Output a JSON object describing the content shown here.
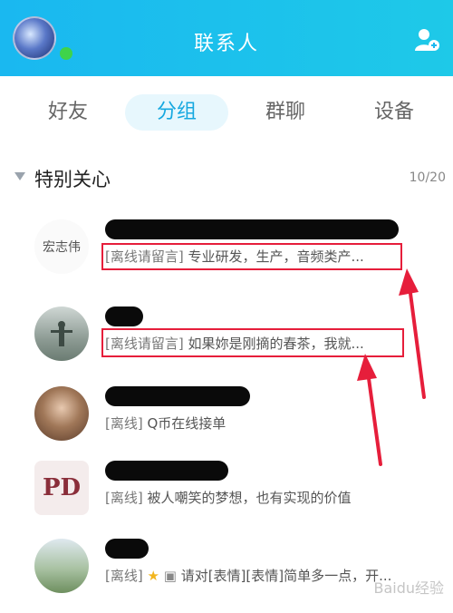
{
  "header": {
    "title": "联系人"
  },
  "tabs": [
    {
      "label": "好友"
    },
    {
      "label": "分组",
      "active": true
    },
    {
      "label": "群聊"
    },
    {
      "label": "设备"
    }
  ],
  "group": {
    "title": "特别关心",
    "count": "10/20",
    "expanded": true
  },
  "contacts": [
    {
      "avatar_text": "宏志伟",
      "status_tag": "[离线请留言]",
      "status_text": "专业研发，生产，音频类产..."
    },
    {
      "avatar_text": "",
      "status_tag": "[离线请留言]",
      "status_text": "如果妳是刚摘的春茶，我就..."
    },
    {
      "avatar_text": "",
      "status_tag": "[离线]",
      "status_text": "Q币在线接单"
    },
    {
      "avatar_text": "PD",
      "status_tag": "[离线]",
      "status_text": "被人嘲笑的梦想，也有实现的价值"
    },
    {
      "avatar_text": "",
      "status_tag": "[离线]",
      "status_text": "请对[表情][表情]简单多一点，开..."
    }
  ],
  "watermark": "Baidu经验",
  "colors": {
    "header": "#1ab8f0",
    "accent": "#16a8e0",
    "highlight": "#e61e3b",
    "online": "#3fd34a"
  }
}
